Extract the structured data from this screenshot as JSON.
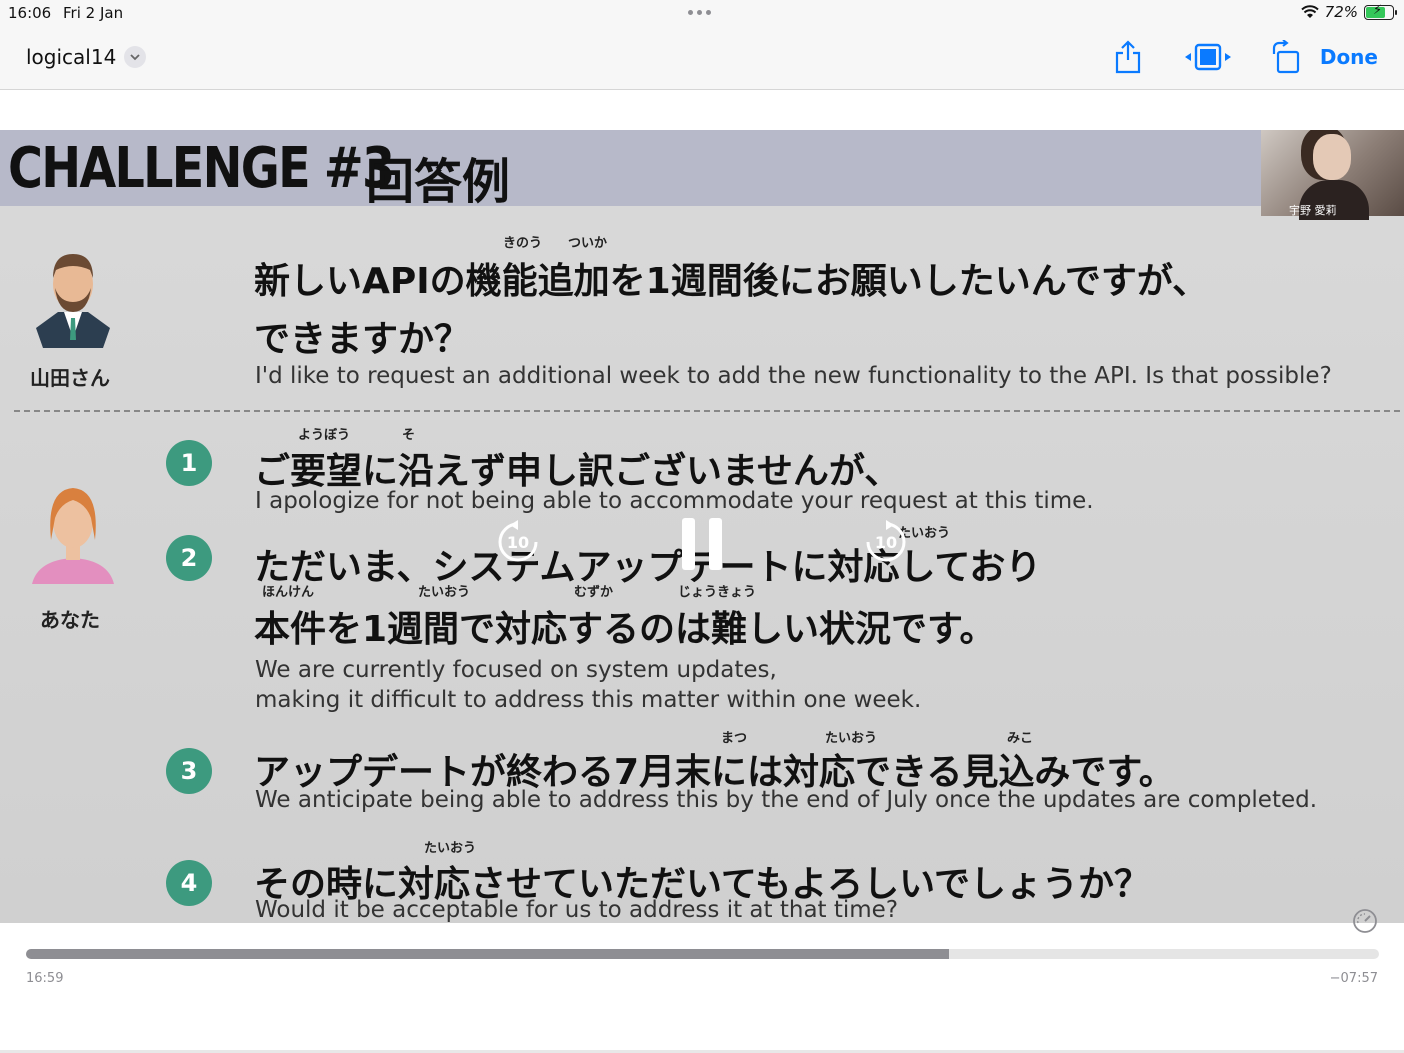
{
  "status": {
    "time": "16:06",
    "date": "Fri 2 Jan",
    "battery": "72%",
    "battery_level": 0.72
  },
  "nav": {
    "title": "logical14",
    "done_label": "Done"
  },
  "slide": {
    "challenge": "CHALLENGE #3",
    "challenge_jp": "回答例",
    "webcam_caption": "宇野 愛莉",
    "person_a": "山田さん",
    "person_b": "あなた",
    "question_jp_1": "新しいAPIの機能追加を1週間後にお願いしたいんですが、",
    "question_jp_2": "できますか？",
    "question_ruby": "きのう　　ついか",
    "question_en": "I'd like to request an additional week to add the new functionality to the API. Is that possible?",
    "answers": [
      {
        "num": "1",
        "ruby": "ようぼう　　　　そ",
        "jp": "ご要望に沿えず申し訳ございませんが、",
        "en": "I apologize for not being able to accommodate your request at this time."
      },
      {
        "num": "2",
        "ruby": "たいおう",
        "jp": "ただいま、システムアップデートに対応しており",
        "jp2": "本件を1週間で対応するのは難しい状況です。",
        "ruby2": "ほんけん　　　　　　　　たいおう　　　　　　　　むずか　　　　　じょうきょう",
        "en": "We are currently focused on system updates,",
        "en2": "making it difficult to address this matter within one week."
      },
      {
        "num": "3",
        "ruby": "まつ　　　　　　たいおう　　　　　　　　　　みこ",
        "jp": "アップデートが終わる7月末には対応できる見込みです。",
        "en": "We anticipate being able to address this by the end of July once the updates are completed."
      },
      {
        "num": "4",
        "ruby": "たいおう",
        "jp": "その時に対応させていただいてもよろしいでしょうか？",
        "en": "Would it be acceptable for us to address it at that time?"
      }
    ]
  },
  "controls": {
    "skip_back": "10",
    "skip_forward": "10"
  },
  "timeline": {
    "elapsed": "16:59",
    "remaining": "−07:57",
    "progress": 0.682
  }
}
